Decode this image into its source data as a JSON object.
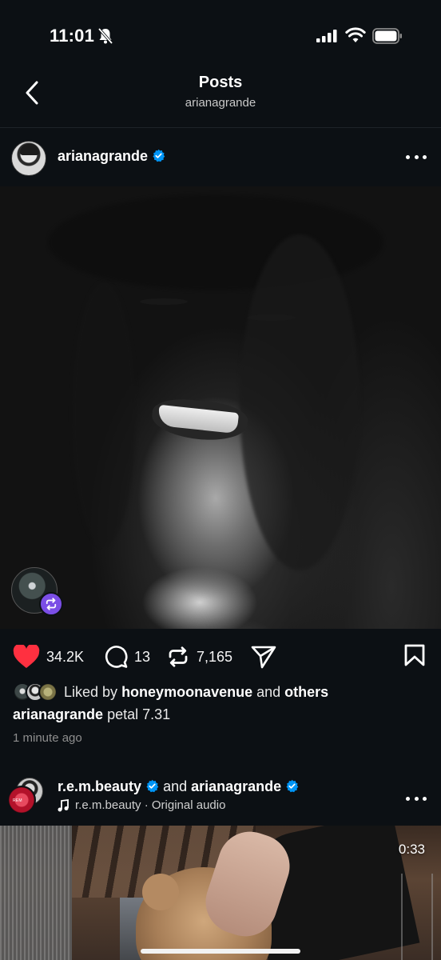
{
  "status_bar": {
    "time": "11:01"
  },
  "header": {
    "title": "Posts",
    "subtitle": "arianagrande"
  },
  "post1": {
    "username": "arianagrande",
    "verified": true,
    "actions": {
      "likes": "34.2K",
      "comments": "13",
      "reposts": "7,165"
    },
    "liked_by_prefix": "Liked by",
    "liked_by_user": "honeymoonavenue",
    "liked_by_join": "and",
    "liked_by_others": "others",
    "caption_user": "arianagrande",
    "caption_text": "petal 7.31",
    "timestamp": "1 minute ago"
  },
  "post2": {
    "user1": "r.e.m.beauty",
    "join": "and",
    "user2": "arianagrande",
    "audio": "r.e.m.beauty · Original audio",
    "video_time": "0:33"
  },
  "colors": {
    "background": "#0c1014",
    "like_red": "#ff3040",
    "verified_blue": "#0095f6",
    "repost_purple": "#7b4ee6"
  },
  "icons": [
    "back-chevron-icon",
    "verified-badge-icon",
    "more-dots-icon",
    "heart-icon",
    "comment-icon",
    "repost-icon",
    "share-icon",
    "bookmark-icon",
    "music-note-icon"
  ]
}
